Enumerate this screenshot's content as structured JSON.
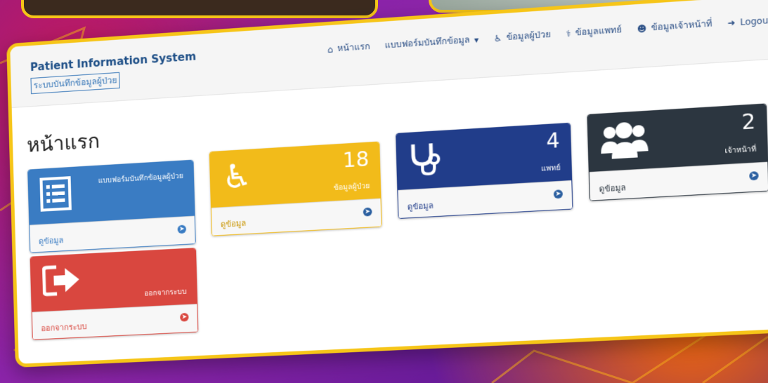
{
  "app": {
    "brand_title": "Patient Information System",
    "brand_subtitle": "ระบบบันทึกข้อมูลผู้ป่วย"
  },
  "nav": {
    "home": "หน้าแรก",
    "record_form": "แบบฟอร์มบันทึกข้อมูล",
    "patients": "ข้อมูลผู้ป่วย",
    "doctors": "ข้อมูลแพทย์",
    "staff": "ข้อมูลเจ้าหน้าที่",
    "logout": "Logout"
  },
  "page": {
    "title": "หน้าแรก"
  },
  "cards": {
    "form": {
      "label": "แบบฟอร์มบันทึกข้อมูลผู้ป่วย",
      "link": "ดูข้อมูล",
      "icon": "list-icon",
      "color": "#3a7cc3"
    },
    "patients": {
      "count": "18",
      "label": "ข้อมูลผู้ป่วย",
      "link": "ดูข้อมูล",
      "icon": "wheelchair-icon",
      "color": "#f2bb1a"
    },
    "doctors": {
      "count": "4",
      "label": "แพทย์",
      "link": "ดูข้อมูล",
      "icon": "stethoscope-icon",
      "color": "#213d8a"
    },
    "staff": {
      "count": "2",
      "label": "เจ้าหน้าที่",
      "link": "ดูข้อมูล",
      "icon": "users-icon",
      "color": "#2c3640"
    },
    "logout": {
      "label": "ออกจากระบบ",
      "link": "ออกจากระบบ",
      "icon": "sign-out-icon",
      "color": "#d9473f"
    }
  }
}
